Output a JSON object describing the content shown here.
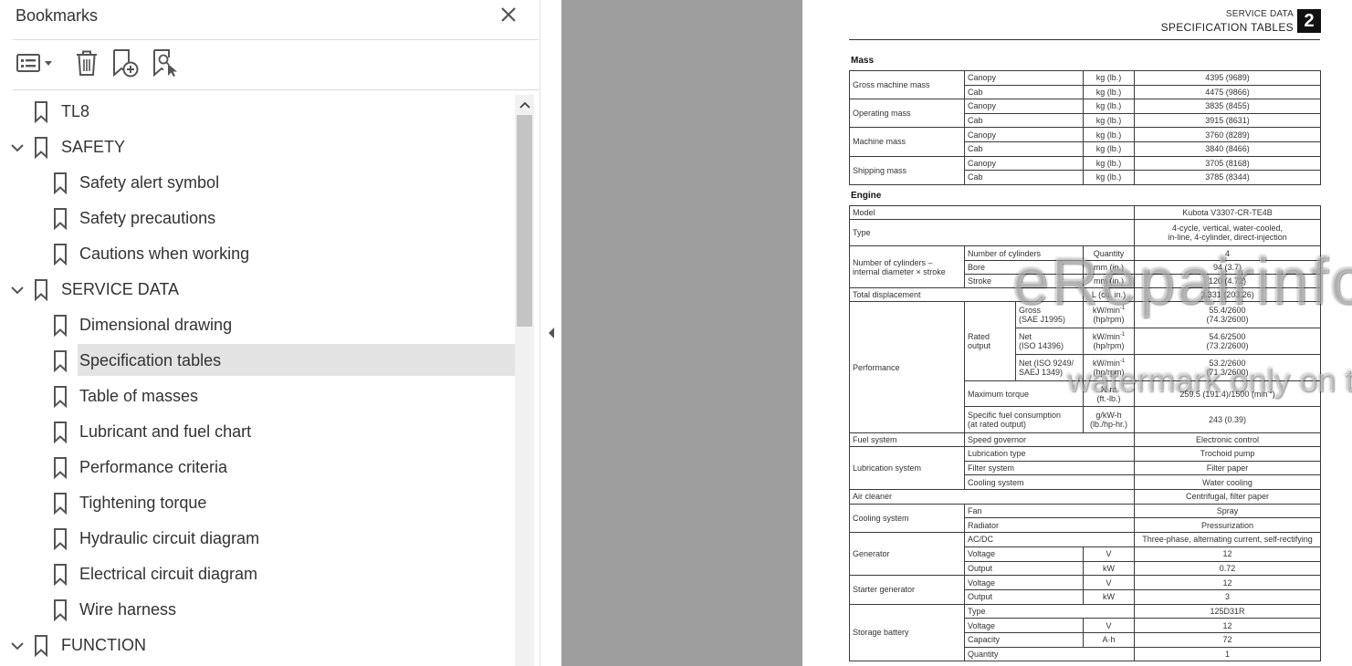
{
  "panel": {
    "title": "Bookmarks",
    "items": [
      {
        "label": "TL8",
        "level": 0,
        "expandable": false
      },
      {
        "label": "SAFETY",
        "level": 0,
        "expandable": true
      },
      {
        "label": "Safety alert symbol",
        "level": 1
      },
      {
        "label": "Safety precautions",
        "level": 1
      },
      {
        "label": "Cautions when working",
        "level": 1
      },
      {
        "label": "SERVICE DATA",
        "level": 0,
        "expandable": true
      },
      {
        "label": "Dimensional drawing",
        "level": 1
      },
      {
        "label": "Specification tables",
        "level": 1,
        "selected": true
      },
      {
        "label": "Table of masses",
        "level": 1
      },
      {
        "label": "Lubricant and fuel chart",
        "level": 1
      },
      {
        "label": "Performance criteria",
        "level": 1
      },
      {
        "label": "Tightening torque",
        "level": 1
      },
      {
        "label": "Hydraulic circuit diagram",
        "level": 1
      },
      {
        "label": "Electrical circuit diagram",
        "level": 1
      },
      {
        "label": "Wire harness",
        "level": 1
      },
      {
        "label": "FUNCTION",
        "level": 0,
        "expandable": true
      }
    ]
  },
  "doc": {
    "section": "SERVICE DATA",
    "title": "SPECIFICATION TABLES",
    "chapter": "2",
    "mass": {
      "heading": "Mass",
      "groups": [
        {
          "name": "Gross machine mass",
          "rows": [
            [
              "Canopy",
              "kg (lb.)",
              "4395 (9689)"
            ],
            [
              "Cab",
              "kg (lb.)",
              "4475 (9866)"
            ]
          ]
        },
        {
          "name": "Operating mass",
          "rows": [
            [
              "Canopy",
              "kg (lb.)",
              "3835 (8455)"
            ],
            [
              "Cab",
              "kg (lb.)",
              "3915 (8631)"
            ]
          ]
        },
        {
          "name": "Machine mass",
          "rows": [
            [
              "Canopy",
              "kg (lb.)",
              "3760 (8289)"
            ],
            [
              "Cab",
              "kg (lb.)",
              "3840 (8466)"
            ]
          ]
        },
        {
          "name": "Shipping mass",
          "rows": [
            [
              "Canopy",
              "kg (lb.)",
              "3705 (8168)"
            ],
            [
              "Cab",
              "kg (lb.)",
              "3785 (8344)"
            ]
          ]
        }
      ]
    },
    "engine": {
      "heading": "Engine",
      "model_label": "Model",
      "model_value": "Kubota V3307-CR-TE4B",
      "type_label": "Type",
      "type_value_1": "4-cycle, vertical, water-cooled,",
      "type_value_2": "in-line, 4-cylinder, direct-injection",
      "cyl_label_1": "Number of cylinders –",
      "cyl_label_2": "internal diameter × stroke",
      "cyl_rows": [
        [
          "Number of cylinders",
          "Quantity",
          "4"
        ],
        [
          "Bore",
          "mm (in.)",
          "94 (3.7)"
        ],
        [
          "Stroke",
          "mm (in.)",
          "120 (4.72)"
        ]
      ],
      "displacement": [
        "Total displacement",
        "L (cu. in.)",
        "3.331 (203.26)"
      ],
      "perf_label": "Performance",
      "rated_1": "Rated",
      "rated_2": "output",
      "rated_rows": [
        [
          "Gross",
          "(SAE J1995)",
          "kW/min",
          "(hp/rpm)",
          "55.4/2600",
          "(74.3/2600)"
        ],
        [
          "Net",
          "(ISO 14396)",
          "kW/min",
          "(hp/rpm)",
          "54.6/2500",
          "(73.2/2600)"
        ],
        [
          "Net (ISO 9249/",
          "SAEJ 1349)",
          "kW/min",
          "(hp/rpm)",
          "53.2/2600",
          "(71.3/2600)"
        ]
      ],
      "sup_minus1": "-1",
      "max_torque": [
        "Maximum torque",
        "N·m",
        "(ft.-lb.)",
        "259.5 (191.4)/1500 (min"
      ],
      "torque_close": ")",
      "fuel_cons": [
        "Specific fuel consumption",
        "(at rated output)",
        "g/kW-h",
        "(lb./hp-hr.)",
        "243 (0.39)"
      ],
      "fuel_system": [
        "Fuel system",
        "Speed governor",
        "Electronic control"
      ],
      "lubrication": {
        "name": "Lubrication system",
        "rows": [
          [
            "Lubrication type",
            "Trochoid pump"
          ],
          [
            "Filter system",
            "Filter paper"
          ],
          [
            "Cooling system",
            "Water cooling"
          ]
        ]
      },
      "air_cleaner": [
        "Air cleaner",
        "Centrifugal, filter paper"
      ],
      "cooling": {
        "name": "Cooling system",
        "rows": [
          [
            "Fan",
            "Spray"
          ],
          [
            "Radiator",
            "Pressurization"
          ]
        ]
      },
      "generator": {
        "name": "Generator",
        "acdc": [
          "AC/DC",
          "Three-phase, alternating current, self-rectifying"
        ],
        "rows": [
          [
            "Voltage",
            "V",
            "12"
          ],
          [
            "Output",
            "kW",
            "0.72"
          ]
        ]
      },
      "starter": {
        "name": "Starter generator",
        "rows": [
          [
            "Voltage",
            "V",
            "12"
          ],
          [
            "Output",
            "kW",
            "3"
          ]
        ]
      },
      "battery": {
        "name": "Storage battery",
        "type": [
          "Type",
          "125D31R"
        ],
        "rows": [
          [
            "Voltage",
            "V",
            "12"
          ],
          [
            "Capacity",
            "A·h",
            "72"
          ]
        ],
        "quantity": [
          "Quantity",
          "1"
        ]
      }
    }
  },
  "watermark": {
    "line1": "eRepairinfo.com",
    "line2": "watermark only on this sample"
  }
}
